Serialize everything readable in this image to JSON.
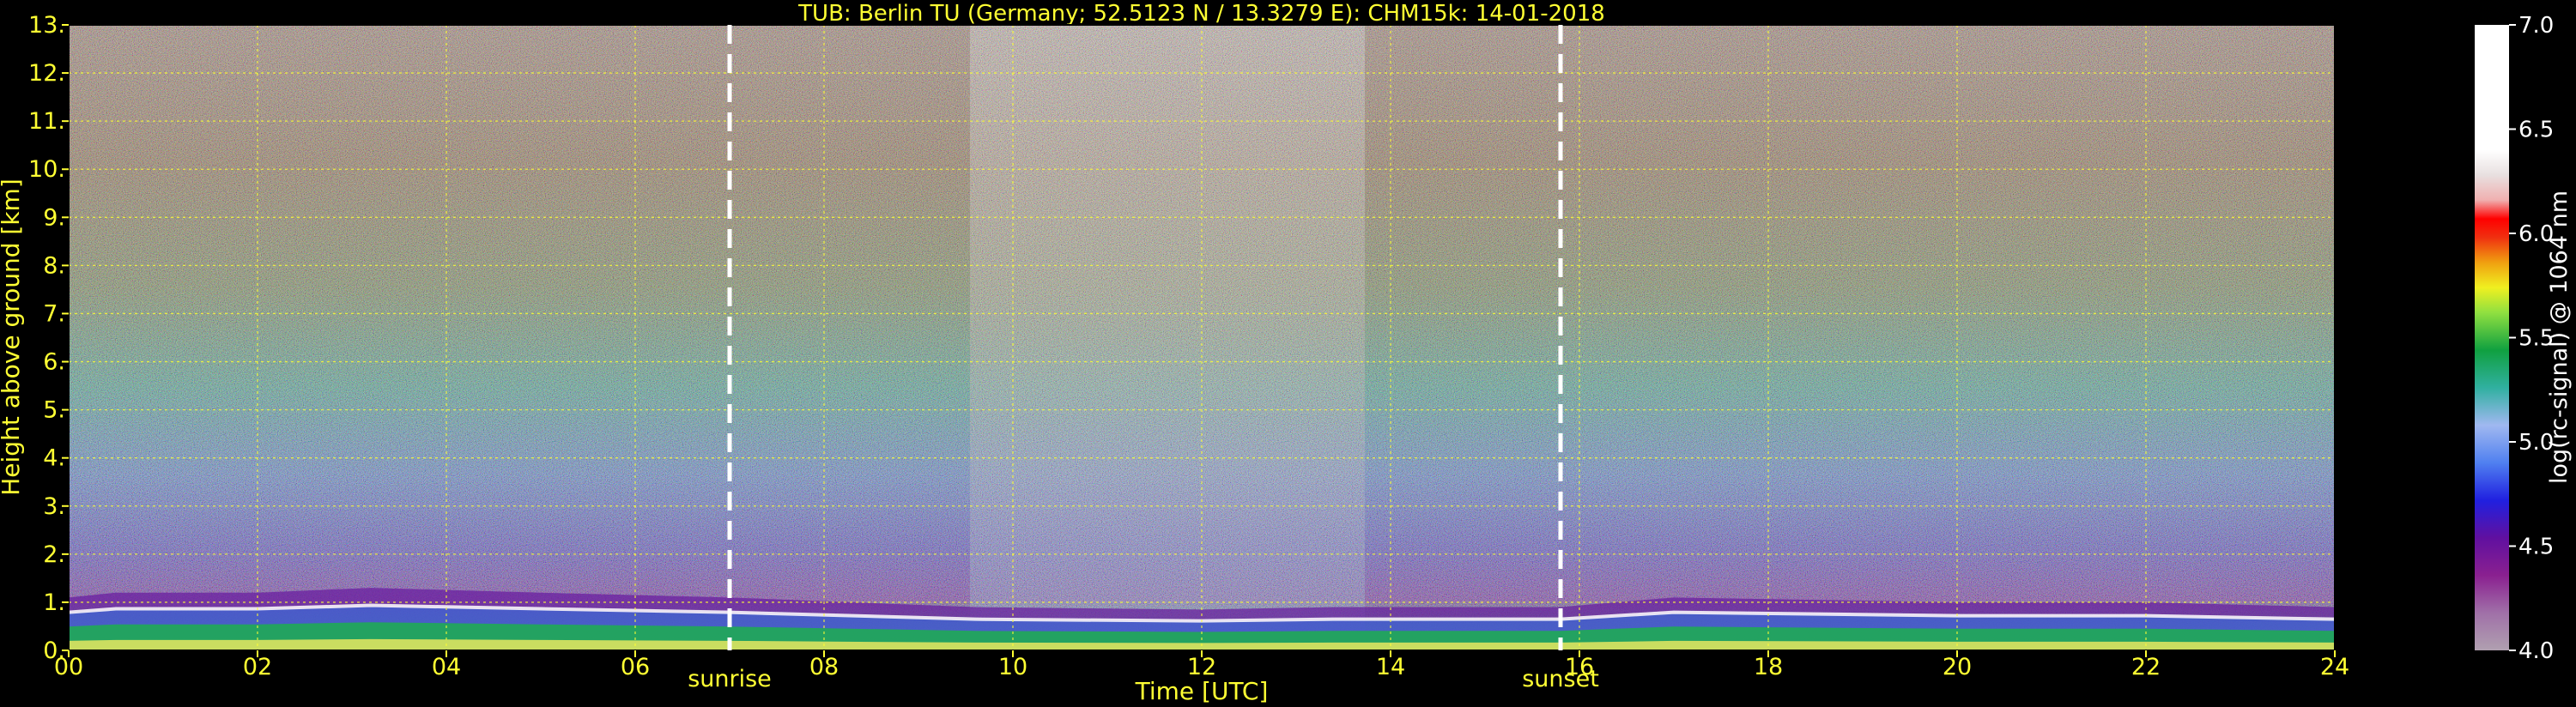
{
  "chart_data": {
    "type": "heatmap",
    "title": "TUB: Berlin TU (Germany; 52.5123 N / 13.3279 E):    CHM15k: 14-01-2018",
    "xlabel": "Time [UTC]",
    "ylabel": "Height above ground [km]",
    "xlim": [
      0,
      24
    ],
    "ylim": [
      0,
      13
    ],
    "x_ticks": [
      "00",
      "02",
      "04",
      "06",
      "08",
      "10",
      "12",
      "14",
      "16",
      "18",
      "20",
      "22",
      "24"
    ],
    "y_ticks": [
      "0.",
      "1.",
      "2.",
      "3.",
      "4.",
      "5.",
      "6.",
      "7.",
      "8.",
      "9.",
      "10.",
      "11.",
      "12.",
      "13."
    ],
    "grid": true,
    "markers": [
      {
        "label": "sunrise",
        "x": 7.0
      },
      {
        "label": "sunset",
        "x": 15.8
      }
    ],
    "colorbar": {
      "label": "log(rc-signal) @ 1064 nm",
      "range": [
        4.0,
        7.0
      ],
      "ticks": [
        "4.0",
        "4.5",
        "5.0",
        "5.5",
        "6.0",
        "6.5",
        "7.0"
      ]
    },
    "aerosol_layer_top_km": [
      [
        0.0,
        1.1
      ],
      [
        0.5,
        1.2
      ],
      [
        2.0,
        1.2
      ],
      [
        3.2,
        1.3
      ],
      [
        5.0,
        1.2
      ],
      [
        7.0,
        1.1
      ],
      [
        9.6,
        0.9
      ],
      [
        12.0,
        0.85
      ],
      [
        13.4,
        0.9
      ],
      [
        15.8,
        0.9
      ],
      [
        17.0,
        1.1
      ],
      [
        20.0,
        1.0
      ],
      [
        22.0,
        1.0
      ],
      [
        24.0,
        0.9
      ]
    ]
  }
}
